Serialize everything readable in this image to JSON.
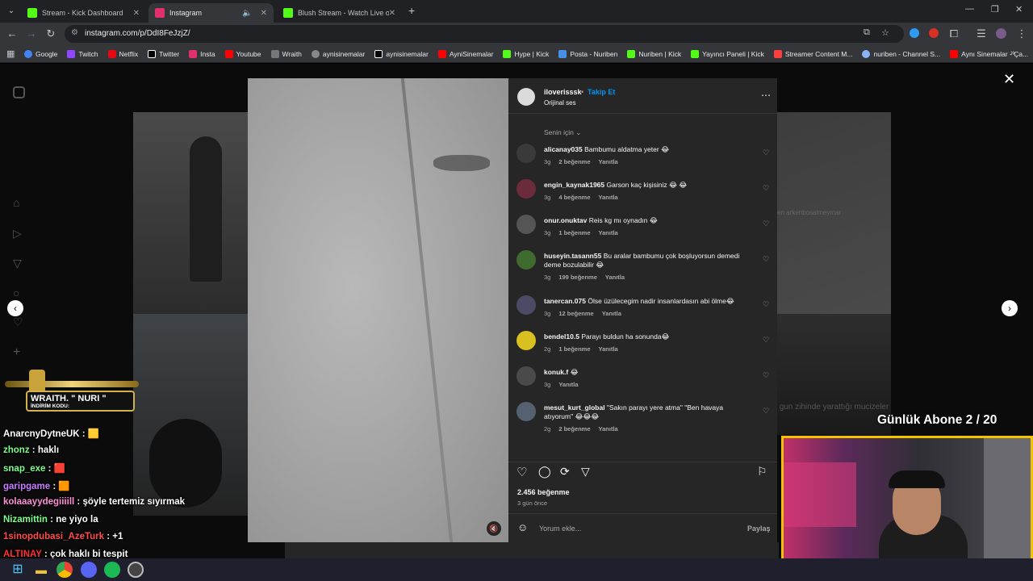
{
  "browser": {
    "tabs": [
      {
        "title": "Stream - Kick Dashboard",
        "color": "#53fc18"
      },
      {
        "title": "Instagram",
        "color": "#e1306c"
      },
      {
        "title": "Blush Stream - Watch Live on K",
        "color": "#53fc18"
      }
    ],
    "url": "instagram.com/p/DdI8FeJzjZ/",
    "bookmarks": [
      {
        "label": "Google",
        "color": "#4285f4"
      },
      {
        "label": "Twitch",
        "color": "#9146ff"
      },
      {
        "label": "Netflix",
        "color": "#e50914"
      },
      {
        "label": "Twitter",
        "color": "#ffffff"
      },
      {
        "label": "Insta",
        "color": "#e1306c"
      },
      {
        "label": "Youtube",
        "color": "#ff0000"
      },
      {
        "label": "Wraith",
        "color": "#cccccc"
      },
      {
        "label": "aynisinemalar",
        "color": "#888888"
      },
      {
        "label": "aynisinemalar",
        "color": "#ffffff"
      },
      {
        "label": "AyniSinemalar",
        "color": "#ff0000"
      },
      {
        "label": "Hype | Kick",
        "color": "#53fc18"
      },
      {
        "label": "Posta - Nuriben",
        "color": "#4a8fe7"
      },
      {
        "label": "Nuriben | Kick",
        "color": "#53fc18"
      },
      {
        "label": "Yayıncı Paneli | Kick",
        "color": "#53fc18"
      },
      {
        "label": "Streamer Content M...",
        "color": "#ff3d3d"
      },
      {
        "label": "nuriben - Channel S...",
        "color": "#8ab4f8"
      },
      {
        "label": "Aynı Sinemalar - Ça...",
        "color": "#ff0000"
      }
    ]
  },
  "post": {
    "username": "iloverisssk",
    "follow": "Takip Et",
    "audio": "Orijinal ses",
    "sort": "Senin için",
    "likes": "2.456 beğenme",
    "time": "3 gün önce",
    "comment_placeholder": "Yorum ekle...",
    "share": "Paylaş",
    "comments": [
      {
        "user": "alicanay035",
        "text": "Bambumu aldatma yeter 😂",
        "age": "3g",
        "likes": "2 beğenme",
        "reply": "Yanıtla"
      },
      {
        "user": "engin_kaynak1965",
        "text": "Garson kaç kişisiniz 😂 😂",
        "age": "3g",
        "likes": "4 beğenme",
        "reply": "Yanıtla"
      },
      {
        "user": "onur.onuktav",
        "text": "Reis kg mı oynadın 😂",
        "age": "3g",
        "likes": "1 beğenme",
        "reply": "Yanıtla"
      },
      {
        "user": "huseyin.tasann55",
        "text": "Bu aralar bambumu çok boşluyorsun demedi deme bozulabilir 😂",
        "age": "3g",
        "likes": "199 beğenme",
        "reply": "Yanıtla"
      },
      {
        "user": "tanercan.075",
        "text": "Ölse üzülecegim nadir insanlardasın abi ölme😂",
        "age": "3g",
        "likes": "12 beğenme",
        "reply": "Yanıtla"
      },
      {
        "user": "bendel10.5",
        "text": "Parayı buldun ha sonunda😂",
        "age": "2g",
        "likes": "1 beğenme",
        "reply": "Yanıtla"
      },
      {
        "user": "konuk.f",
        "text": "😂",
        "age": "3g",
        "likes": "",
        "reply": "Yanıtla"
      },
      {
        "user": "mesut_kurt_global",
        "text": "\"Sakın parayı yere atma\" \"Ben havaya atıyorum\" 😂😂😂",
        "age": "2g",
        "likes": "2 beğenme",
        "reply": "Yanıtla"
      }
    ]
  },
  "overlay": {
    "sponsor": "WRAITH. \" NURI \"",
    "sponsor_sub": "İNDİRİM KODU:",
    "subs_goal": "Günlük Abone 2 / 20",
    "bg_caption1": "en arkenbosalmeymar",
    "bg_caption2": "gun zihinde yarattığı mucizeler"
  },
  "chat": [
    {
      "user": "AnarcnyDytneUK",
      "msg": "🟨",
      "color": "#ffffff"
    },
    {
      "user": "zhonz",
      "msg": "haklı",
      "color": "#7dff8a"
    },
    {
      "user": "snap_exe",
      "msg": "🟥",
      "color": "#7dff8a"
    },
    {
      "user": "garipgame",
      "msg": "🟧",
      "color": "#c77dff"
    },
    {
      "user": "kolaaayydegiiiill",
      "msg": "şöyle tertemiz sıyırmak",
      "color": "#ff8fd8"
    },
    {
      "user": "Nizamittin",
      "msg": "ne yiyo la",
      "color": "#7dff8a"
    },
    {
      "user": "1sinopdubasi_AzeTurk",
      "msg": "+1",
      "color": "#ff4d4d"
    },
    {
      "user": "ALTINAY",
      "msg": "çok haklı bi tespit",
      "color": "#ff3030"
    }
  ]
}
